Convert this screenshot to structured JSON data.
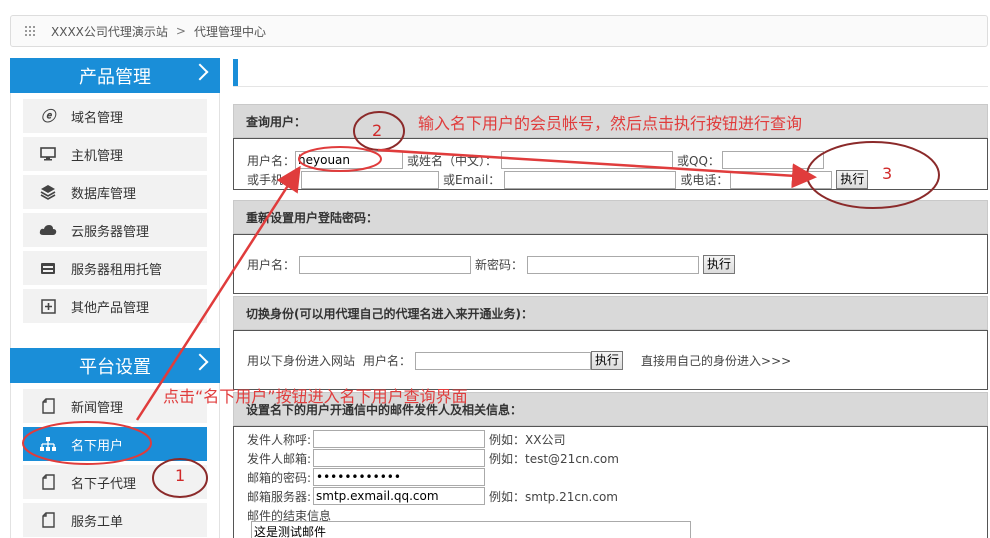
{
  "breadcrumb": {
    "site": "XXXX公司代理演示站",
    "separator": ">",
    "current": "代理管理中心"
  },
  "sidebar": {
    "product": {
      "title": "产品管理",
      "items": [
        {
          "label": "域名管理",
          "icon": "ie-icon"
        },
        {
          "label": "主机管理",
          "icon": "monitor-icon"
        },
        {
          "label": "数据库管理",
          "icon": "layers-icon"
        },
        {
          "label": "云服务器管理",
          "icon": "cloud-icon"
        },
        {
          "label": "服务器租用托管",
          "icon": "server-icon"
        },
        {
          "label": "其他产品管理",
          "icon": "plus-box-icon"
        }
      ]
    },
    "platform": {
      "title": "平台设置",
      "items": [
        {
          "label": "新闻管理",
          "icon": "document-icon"
        },
        {
          "label": "名下用户",
          "icon": "sitemap-icon",
          "active": true
        },
        {
          "label": "名下子代理",
          "icon": "document-icon"
        },
        {
          "label": "服务工单",
          "icon": "document-icon"
        }
      ]
    }
  },
  "query": {
    "title": "查询用户：",
    "username_label": "用户名：",
    "username_value": "heyouan",
    "name_label": "或姓名（中文）：",
    "qq_label": "或QQ：",
    "phone_label": "或手机：",
    "email_label": "或Email：",
    "tel_label": "或电话：",
    "execute": "执行"
  },
  "reset": {
    "title": "重新设置用户登陆密码：",
    "username_label": "用户名：",
    "password_label": "新密码：",
    "execute": "执行"
  },
  "switch": {
    "title": "切换身份(可以用代理自己的代理名进入来开通业务)：",
    "prefix": "用以下身份进入网站",
    "username_label": "用户名：",
    "execute": "执行",
    "direct_link": "直接用自己的身份进入>>>"
  },
  "mail": {
    "title": "设置名下的用户开通信中的邮件发件人及相关信息：",
    "sender_name_label": "发件人称呼:",
    "sender_name_example": "例如：XX公司",
    "sender_email_label": "发件人邮箱:",
    "sender_email_example": "例如：test@21cn.com",
    "password_label": "邮箱的密码:",
    "password_value": "••••••••••••",
    "server_label": "邮箱服务器:",
    "server_value": "smtp.exmail.qq.com",
    "server_example": "例如：smtp.21cn.com",
    "closing_label": "邮件的结束信息",
    "closing_value": "这是测试邮件"
  },
  "annotations": {
    "step1_text": "点击“名下用户”按钮进入名下用户查询界面",
    "step2_text": "输入名下用户的会员帐号，然后点击执行按钮进行查询",
    "num1": "1",
    "num2": "2",
    "num3": "3",
    "color": "#e03c3c"
  }
}
